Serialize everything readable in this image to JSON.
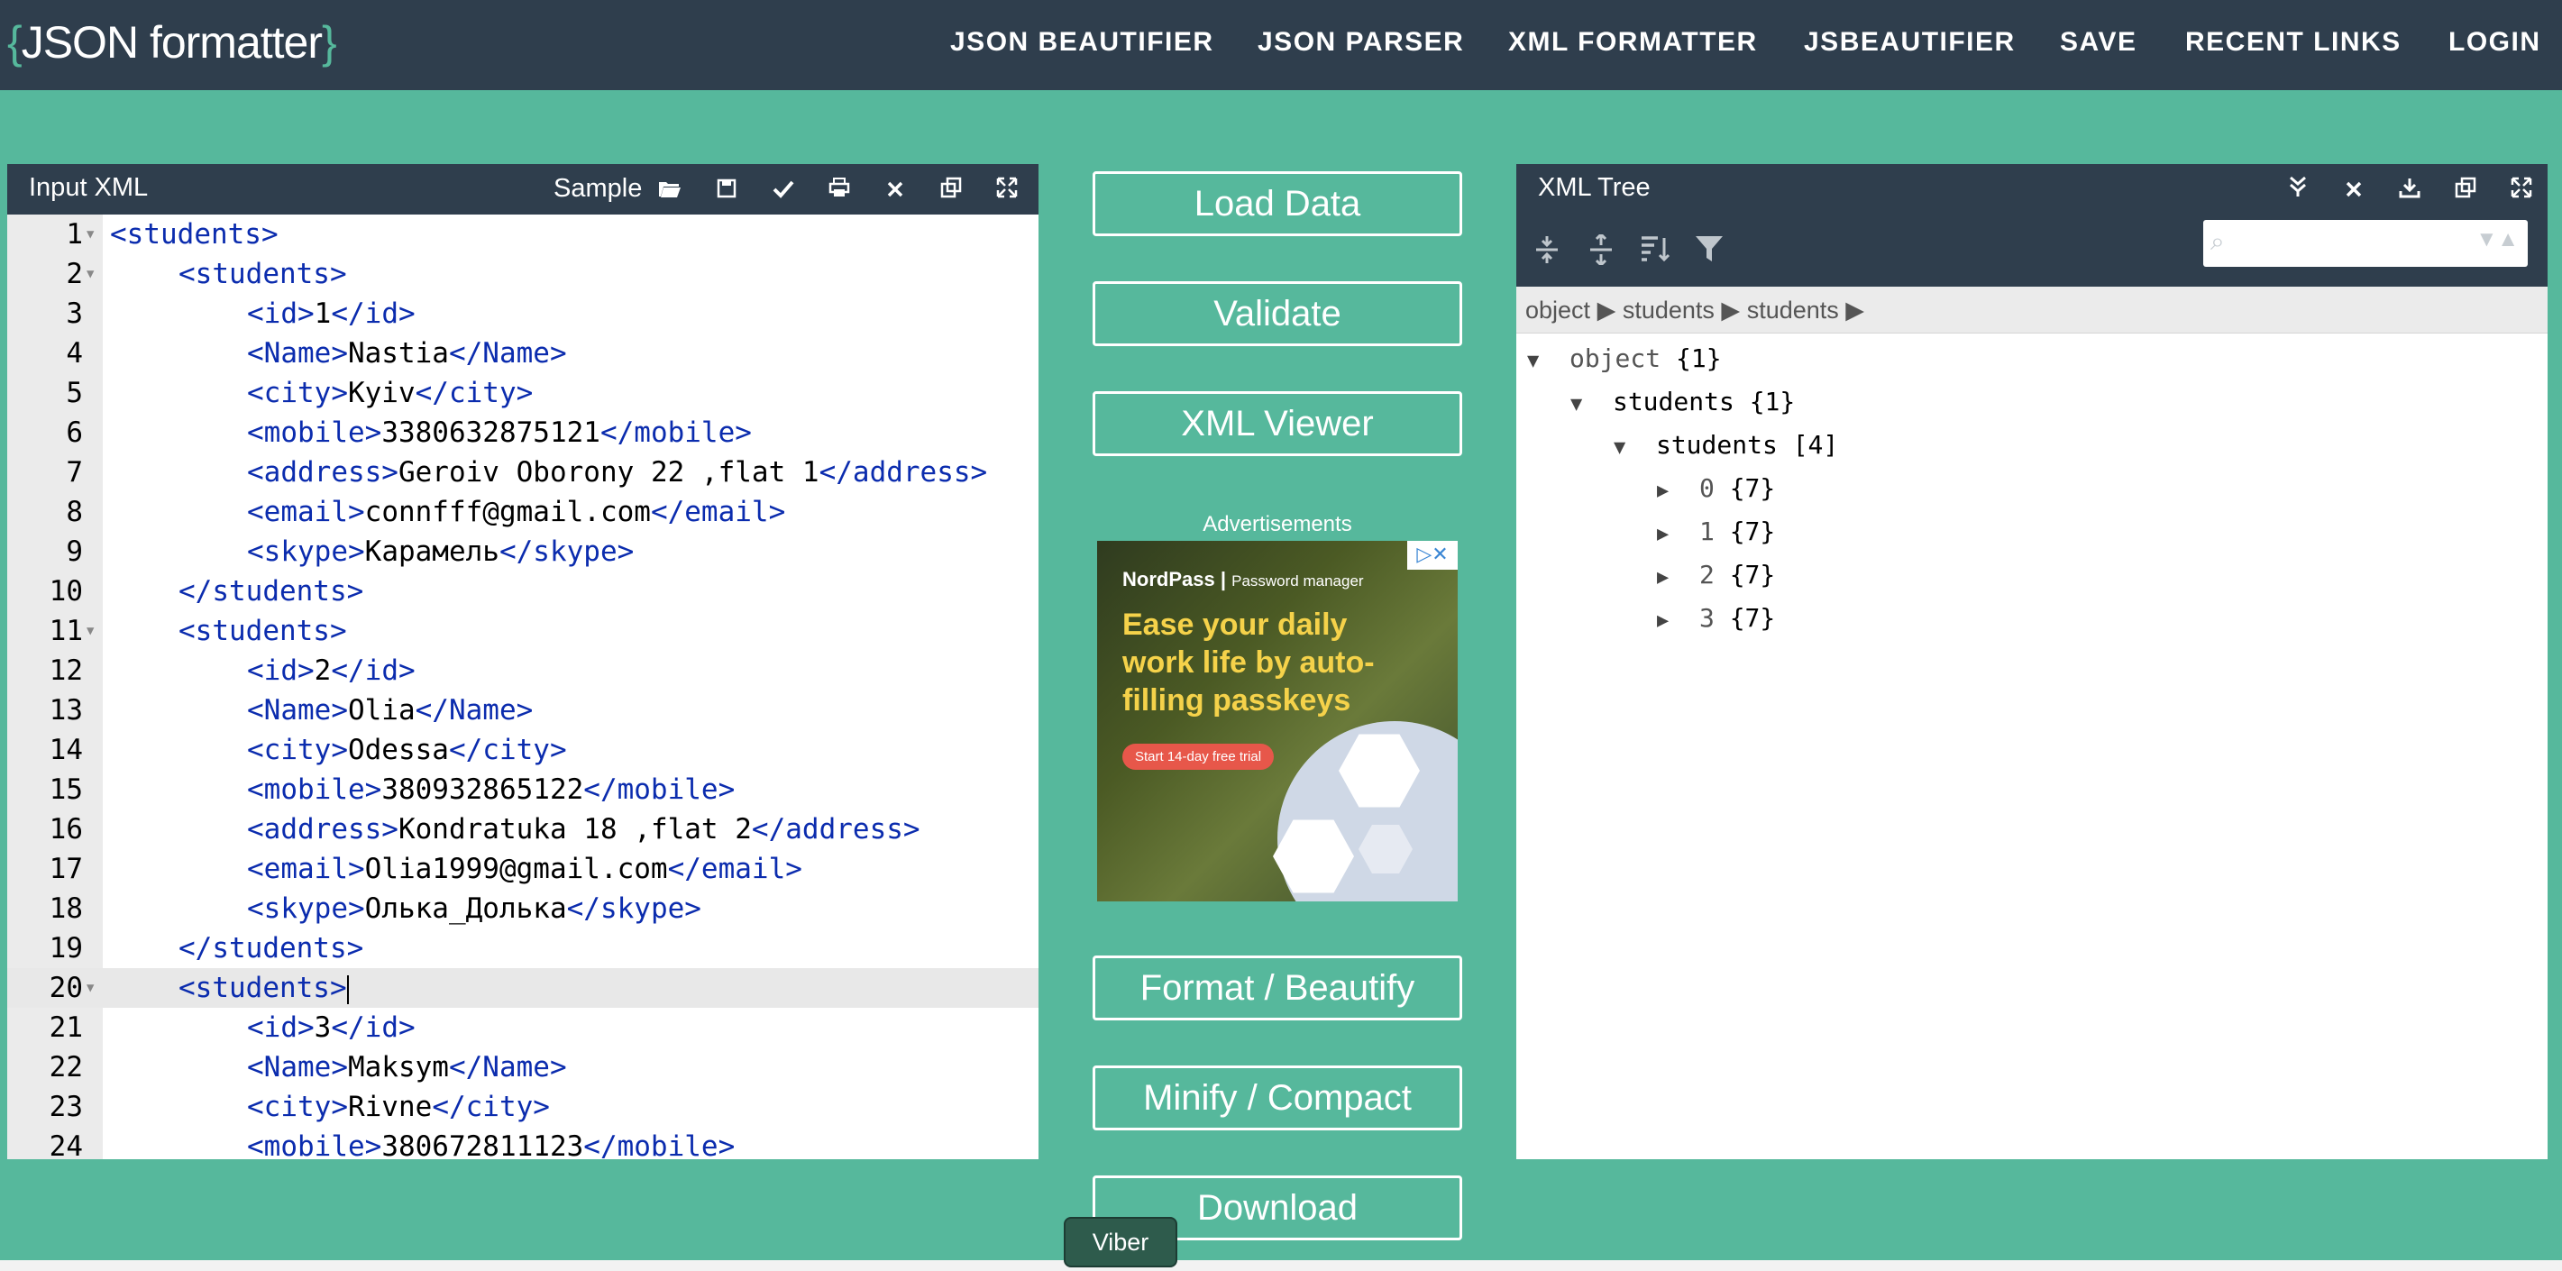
{
  "app": {
    "logo_open": "{",
    "logo_text": "JSON formatter",
    "logo_close": "}"
  },
  "nav": {
    "items": [
      "JSON BEAUTIFIER",
      "JSON PARSER",
      "XML FORMATTER",
      "JSBEAUTIFIER",
      "SAVE",
      "RECENT LINKS",
      "LOGIN"
    ]
  },
  "input_panel": {
    "title": "Input XML",
    "sample_label": "Sample",
    "icons": [
      "folder-open-icon",
      "save-icon",
      "check-icon",
      "print-icon",
      "clear-icon",
      "copy-icon",
      "fullscreen-icon"
    ],
    "lines": [
      {
        "n": "1",
        "fold": true,
        "indent": 0,
        "open": "<students>",
        "text": "",
        "close": ""
      },
      {
        "n": "2",
        "fold": true,
        "indent": 1,
        "open": "<students>",
        "text": "",
        "close": ""
      },
      {
        "n": "3",
        "fold": false,
        "indent": 2,
        "open": "<id>",
        "text": "1",
        "close": "</id>"
      },
      {
        "n": "4",
        "fold": false,
        "indent": 2,
        "open": "<Name>",
        "text": "Nastia",
        "close": "</Name>"
      },
      {
        "n": "5",
        "fold": false,
        "indent": 2,
        "open": "<city>",
        "text": "Kyiv",
        "close": "</city>"
      },
      {
        "n": "6",
        "fold": false,
        "indent": 2,
        "open": "<mobile>",
        "text": "3380632875121",
        "close": "</mobile>"
      },
      {
        "n": "7",
        "fold": false,
        "indent": 2,
        "open": "<address>",
        "text": "Geroiv Oborony 22 ,flat 1",
        "close": "</address>"
      },
      {
        "n": "8",
        "fold": false,
        "indent": 2,
        "open": "<email>",
        "text": "connfff@gmail.com",
        "close": "</email>"
      },
      {
        "n": "9",
        "fold": false,
        "indent": 2,
        "open": "<skype>",
        "text": "Карамель",
        "close": "</skype>"
      },
      {
        "n": "10",
        "fold": false,
        "indent": 1,
        "open": "</students>",
        "text": "",
        "close": ""
      },
      {
        "n": "11",
        "fold": true,
        "indent": 1,
        "open": "<students>",
        "text": "",
        "close": ""
      },
      {
        "n": "12",
        "fold": false,
        "indent": 2,
        "open": "<id>",
        "text": "2",
        "close": "</id>"
      },
      {
        "n": "13",
        "fold": false,
        "indent": 2,
        "open": "<Name>",
        "text": "Olia",
        "close": "</Name>"
      },
      {
        "n": "14",
        "fold": false,
        "indent": 2,
        "open": "<city>",
        "text": "Odessa",
        "close": "</city>"
      },
      {
        "n": "15",
        "fold": false,
        "indent": 2,
        "open": "<mobile>",
        "text": "380932865122",
        "close": "</mobile>"
      },
      {
        "n": "16",
        "fold": false,
        "indent": 2,
        "open": "<address>",
        "text": "Kondratuka 18 ,flat 2",
        "close": "</address>"
      },
      {
        "n": "17",
        "fold": false,
        "indent": 2,
        "open": "<email>",
        "text": "Olia1999@gmail.com",
        "close": "</email>"
      },
      {
        "n": "18",
        "fold": false,
        "indent": 2,
        "open": "<skype>",
        "text": "Олька_Долька",
        "close": "</skype>"
      },
      {
        "n": "19",
        "fold": false,
        "indent": 1,
        "open": "</students>",
        "text": "",
        "close": ""
      },
      {
        "n": "20",
        "fold": true,
        "indent": 1,
        "open": "<students>",
        "text": "",
        "close": "",
        "active": true
      },
      {
        "n": "21",
        "fold": false,
        "indent": 2,
        "open": "<id>",
        "text": "3",
        "close": "</id>"
      },
      {
        "n": "22",
        "fold": false,
        "indent": 2,
        "open": "<Name>",
        "text": "Maksym",
        "close": "</Name>"
      },
      {
        "n": "23",
        "fold": false,
        "indent": 2,
        "open": "<city>",
        "text": "Rivne",
        "close": "</city>"
      },
      {
        "n": "24",
        "fold": false,
        "indent": 2,
        "open": "<mobile>",
        "text": "380672811123",
        "close": "</mobile>"
      }
    ]
  },
  "actions": {
    "load_data": "Load Data",
    "validate": "Validate",
    "xml_viewer": "XML Viewer",
    "format": "Format / Beautify",
    "minify": "Minify / Compact",
    "download": "Download"
  },
  "ads": {
    "label": "Advertisements",
    "brand": "NordPass",
    "brand_sub": "Password manager",
    "headline": "Ease your daily work life by auto-filling passkeys",
    "cta": "Start 14-day free trial"
  },
  "tree_panel": {
    "title": "XML Tree",
    "search_placeholder": "",
    "breadcrumb": [
      "object",
      "students",
      "students"
    ],
    "nodes": [
      {
        "indent": 0,
        "key": "object",
        "count": "{1}",
        "expanded": true,
        "plainKey": true
      },
      {
        "indent": 1,
        "key": "students",
        "count": "{1}",
        "expanded": true
      },
      {
        "indent": 2,
        "key": "students",
        "count": "[4]",
        "expanded": true
      },
      {
        "indent": 3,
        "key": "0",
        "count": "{7}",
        "expanded": false,
        "plainKey": true
      },
      {
        "indent": 3,
        "key": "1",
        "count": "{7}",
        "expanded": false,
        "plainKey": true
      },
      {
        "indent": 3,
        "key": "2",
        "count": "{7}",
        "expanded": false,
        "plainKey": true
      },
      {
        "indent": 3,
        "key": "3",
        "count": "{7}",
        "expanded": false,
        "plainKey": true
      }
    ]
  },
  "tooltip": {
    "label": "Viber"
  },
  "colors": {
    "background": "#56b89c",
    "header": "#2f3e4d",
    "tag": "#0b2cae"
  }
}
